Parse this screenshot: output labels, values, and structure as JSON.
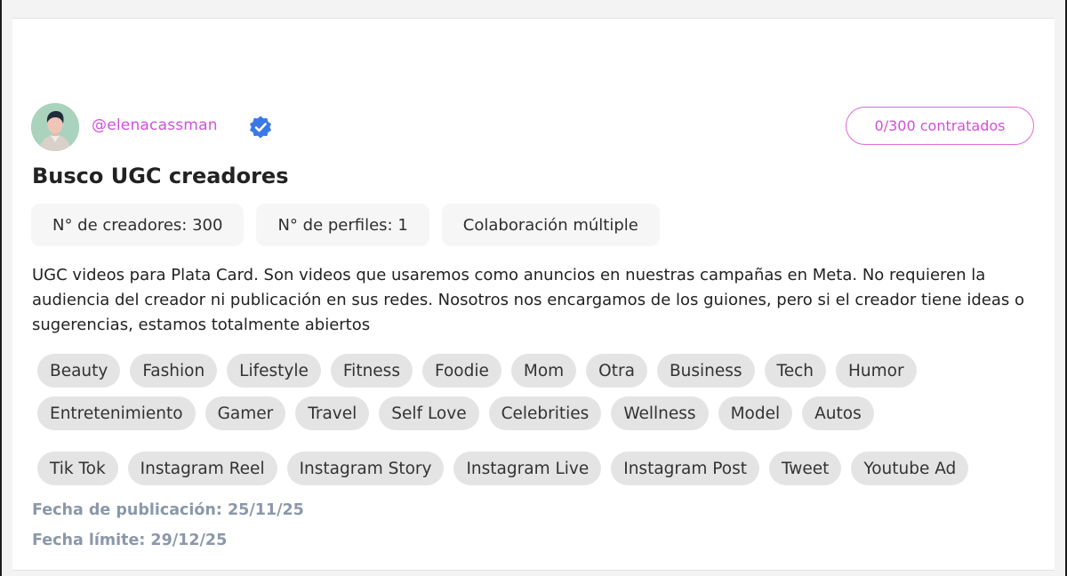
{
  "post": {
    "author_handle": "@elenacassman",
    "hired_badge": "0/300 contratados",
    "title": "Busco UGC creadores",
    "stats": [
      "N° de creadores: 300",
      "N° de perfiles: 1",
      "Colaboración múltiple"
    ],
    "description": "UGC videos para Plata Card. Son videos que usaremos como anuncios en nuestras campañas en Meta. No requieren la audiencia del creador ni publicación en sus redes. Nosotros nos encargamos de los guiones, pero si el creador tiene ideas o sugerencias, estamos totalmente abiertos",
    "categories": [
      "Beauty",
      "Fashion",
      "Lifestyle",
      "Fitness",
      "Foodie",
      "Mom",
      "Otra",
      "Business",
      "Tech",
      "Humor",
      "Entretenimiento",
      "Gamer",
      "Travel",
      "Self Love",
      "Celebrities",
      "Wellness",
      "Model",
      "Autos"
    ],
    "formats": [
      "Tik Tok",
      "Instagram Reel",
      "Instagram Story",
      "Instagram Live",
      "Instagram Post",
      "Tweet",
      "Youtube Ad"
    ],
    "published": "Fecha de publicación: 25/11/25",
    "deadline": "Fecha límite: 29/12/25"
  },
  "icons": {
    "avatar": "avatar-placeholder",
    "verified": "verified-badge-icon"
  },
  "colors": {
    "accent": "#d44fd8",
    "verified": "#3a78e8",
    "date_text": "#8b98aa"
  }
}
